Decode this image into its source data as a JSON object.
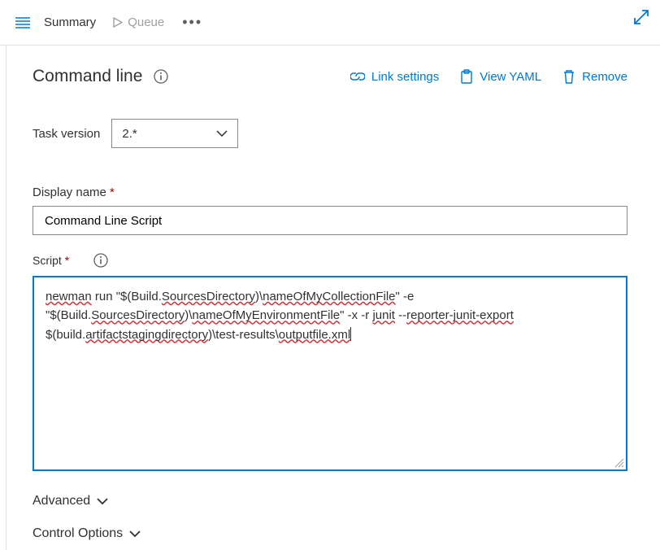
{
  "topbar": {
    "summary_label": "Summary",
    "queue_label": "Queue",
    "more_label": "…"
  },
  "page": {
    "title": "Command line",
    "link_settings": "Link settings",
    "view_yaml": "View YAML",
    "remove": "Remove"
  },
  "task_version": {
    "label": "Task version",
    "value": "2.*"
  },
  "display_name": {
    "label": "Display name",
    "value": "Command Line Script"
  },
  "script": {
    "label": "Script",
    "segments": {
      "t1": "newman",
      "t2": " run \"$(Build.",
      "t3": "SourcesDirectory",
      "t4": ")\\",
      "t5": "nameOfMyCollectionFile",
      "t6": "\" -e \"$(Build.",
      "t7": "SourcesDirectory",
      "t8": ")\\",
      "t9": "nameOfMyEnvironmentFile",
      "t10": "\" -x -r ",
      "t11": "junit",
      "t12": " --",
      "t13": "reporter-junit-export",
      "t14": " $(build.",
      "t15": "artifactstagingdirectory",
      "t16": ")\\test-results\\",
      "t17": "outputfile.xml"
    }
  },
  "sections": {
    "advanced": "Advanced",
    "control_options": "Control Options"
  }
}
